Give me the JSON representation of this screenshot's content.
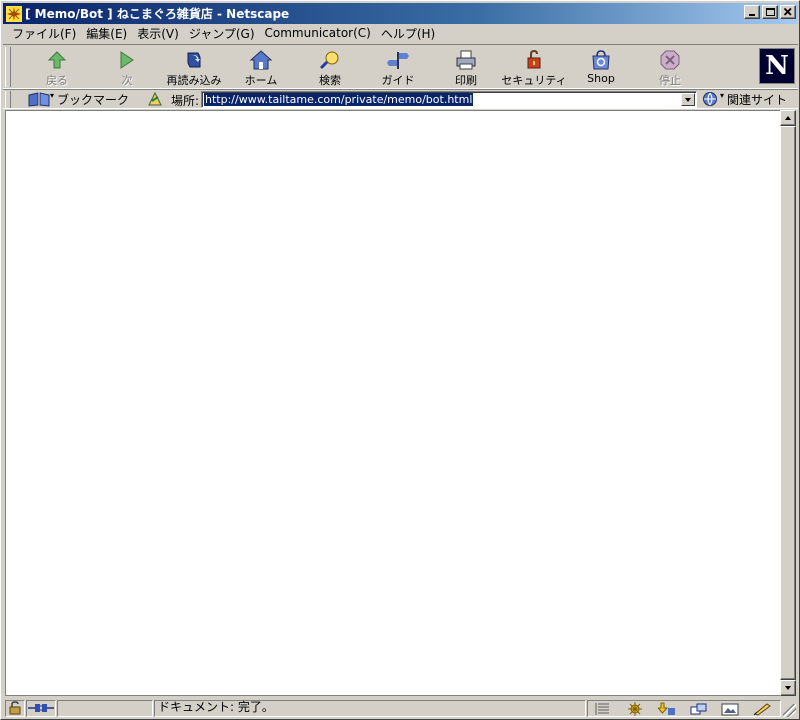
{
  "window": {
    "title": "[ Memo/Bot ] ねこまぐろ雑貨店 - Netscape",
    "controls": {
      "minimize": "_",
      "maximize": "□",
      "close": "×"
    }
  },
  "menubar": {
    "items": [
      "ファイル(F)",
      "編集(E)",
      "表示(V)",
      "ジャンプ(G)",
      "Communicator(C)",
      "ヘルプ(H)"
    ]
  },
  "toolbar": {
    "buttons": [
      {
        "label": "戻る",
        "icon": "back-arrow-icon",
        "enabled": false
      },
      {
        "label": "次",
        "icon": "forward-arrow-icon",
        "enabled": false
      },
      {
        "label": "再読み込み",
        "icon": "reload-icon",
        "enabled": true
      },
      {
        "label": "ホーム",
        "icon": "home-icon",
        "enabled": true
      },
      {
        "label": "検索",
        "icon": "search-icon",
        "enabled": true
      },
      {
        "label": "ガイド",
        "icon": "guide-icon",
        "enabled": true
      },
      {
        "label": "印刷",
        "icon": "print-icon",
        "enabled": true
      },
      {
        "label": "セキュリティ",
        "icon": "security-lock-icon",
        "enabled": true
      },
      {
        "label": "Shop",
        "icon": "shop-icon",
        "enabled": true
      },
      {
        "label": "停止",
        "icon": "stop-icon",
        "enabled": false
      }
    ],
    "logo": "N"
  },
  "locationbar": {
    "bookmarks_label": "ブックマーク",
    "location_label": "場所:",
    "url": "http://www.tailtame.com/private/memo/bot.html",
    "related_label": "関連サイト"
  },
  "statusbar": {
    "text": "ドキュメント: 完了。"
  },
  "colors": {
    "title_active": "#0a246a",
    "chrome": "#d4d0c8",
    "selection": "#0a246a"
  }
}
